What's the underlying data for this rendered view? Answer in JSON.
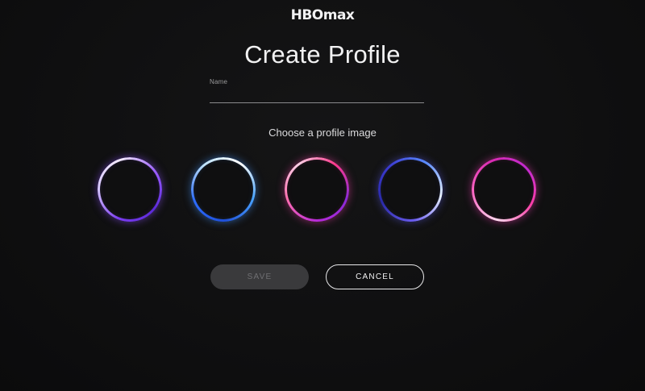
{
  "header": {
    "logo_text": "HBOmax"
  },
  "main": {
    "title": "Create Profile",
    "name_field": {
      "label": "Name",
      "value": ""
    },
    "choose_label": "Choose a profile image",
    "avatars": [
      {
        "name": "purple ring",
        "color": "#7a3cf0"
      },
      {
        "name": "blue ring",
        "color": "#2e6dff"
      },
      {
        "name": "magenta ring",
        "color": "#b72ad9"
      },
      {
        "name": "indigo ring",
        "color": "#3b3ad0"
      },
      {
        "name": "pink ring",
        "color": "#ff3fa8"
      }
    ],
    "buttons": {
      "save_label": "SAVE",
      "cancel_label": "CANCEL"
    }
  },
  "colors": {
    "background": "#0f0f10",
    "save_disabled_bg": "#3a3a3c",
    "text": "#f1f1f2"
  }
}
